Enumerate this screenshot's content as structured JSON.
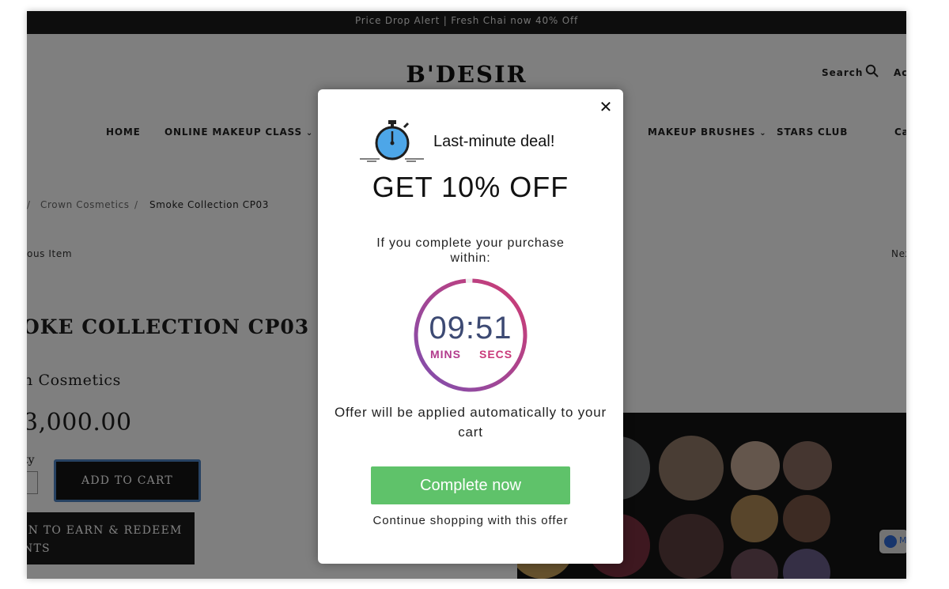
{
  "announcement": "Price Drop Alert | Fresh Chai now 40% Off",
  "header": {
    "brand": "B'DESIR",
    "search_label": "Search",
    "account_label": "Ac"
  },
  "nav": {
    "home": "HOME",
    "online_makeup_class": "ONLINE MAKEUP CLASS",
    "makeup_brushes": "MAKEUP BRUSHES",
    "stars_club": "STARS CLUB",
    "cart": "Ca",
    "chevron": "⌄"
  },
  "breadcrumb": {
    "sep1": "/",
    "collection": "Crown Cosmetics",
    "sep2": "/",
    "current": "Smoke Collection CP03"
  },
  "pager": {
    "previous": "ous Item",
    "next": "Nex"
  },
  "product": {
    "title": "OKE COLLECTION CP03",
    "vendor": "n Cosmetics",
    "price": "3,000.00",
    "qty_label": "ty",
    "add_to_cart": "ADD TO CART",
    "earn_line1": "IN TO EARN & REDEEM",
    "earn_line2": "NTS"
  },
  "messenger": {
    "letter": "M"
  },
  "popup": {
    "close": "✕",
    "deal_heading": "Last-minute deal!",
    "headline": "GET 10% OFF",
    "condition": "If you complete your purchase within:",
    "countdown_time": "09:51",
    "countdown_mins_label": "MINS",
    "countdown_secs_label": "SECS",
    "remaining_fraction": 0.98,
    "offer_note": "Offer will be applied automatically to your cart",
    "cta": "Complete now",
    "secondary": "Continue shopping with this offer"
  },
  "colors": {
    "cta_green": "#5fc26a",
    "ring_start": "#7e4fb0",
    "ring_end": "#d03b72",
    "timer_blue": "#3d4a73"
  },
  "icons": {
    "search": "search-icon",
    "close": "close-icon",
    "stopwatch": "stopwatch-icon",
    "messenger": "messenger-icon"
  }
}
